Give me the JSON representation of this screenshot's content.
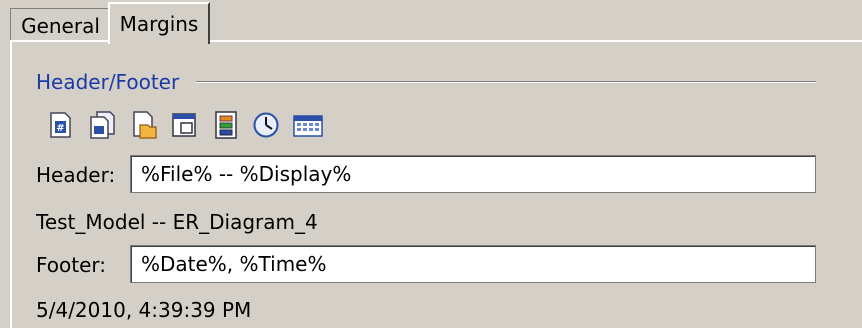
{
  "tabs": [
    {
      "label": "General",
      "active": false
    },
    {
      "label": "Margins",
      "active": true
    }
  ],
  "group": {
    "title": "Header/Footer",
    "title_color": "#1c3aa6"
  },
  "toolbar": {
    "icons": [
      "page-number-icon",
      "page-count-icon",
      "file-name-icon",
      "display-name-icon",
      "model-icon",
      "time-icon",
      "date-icon"
    ]
  },
  "header": {
    "label": "Header:",
    "value": "%File% -- %Display%",
    "preview": "Test_Model -- ER_Diagram_4"
  },
  "footer": {
    "label": "Footer:",
    "value": "%Date%, %Time%",
    "preview": "5/4/2010, 4:39:39 PM"
  }
}
